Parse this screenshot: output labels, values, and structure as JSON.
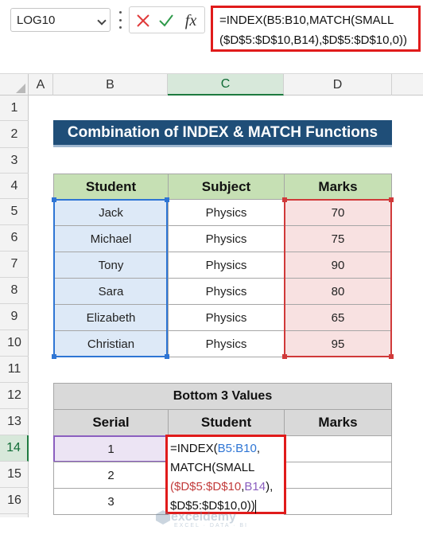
{
  "formula_bar": {
    "name_box": "LOG10",
    "fx_label": "fx",
    "formula_line1": "=INDEX(B5:B10,MATCH(SMALL",
    "formula_line2": "($D$5:$D$10,B14),$D$5:$D$10,0))"
  },
  "columns": [
    "A",
    "B",
    "C",
    "D"
  ],
  "rows": [
    "1",
    "2",
    "3",
    "4",
    "5",
    "6",
    "7",
    "8",
    "9",
    "10",
    "11",
    "12",
    "13",
    "14",
    "15",
    "16"
  ],
  "title": "Combination of INDEX & MATCH Functions",
  "main_table": {
    "headers": [
      "Student",
      "Subject",
      "Marks"
    ],
    "rows": [
      [
        "Jack",
        "Physics",
        "70"
      ],
      [
        "Michael",
        "Physics",
        "75"
      ],
      [
        "Tony",
        "Physics",
        "90"
      ],
      [
        "Sara",
        "Physics",
        "80"
      ],
      [
        "Elizabeth",
        "Physics",
        "65"
      ],
      [
        "Christian",
        "Physics",
        "95"
      ]
    ]
  },
  "bottom_table": {
    "title": "Bottom 3 Values",
    "headers": [
      "Serial",
      "Student",
      "Marks"
    ],
    "serials": [
      "1",
      "2",
      "3"
    ]
  },
  "edit_cell": {
    "l1a": "=INDEX(",
    "l1b": "B5:B10",
    "l1c": ",",
    "l2": "MATCH(SMALL",
    "l3a": "($D$5:$D$10",
    "l3b": ",",
    "l3c": "B14",
    "l3d": "),",
    "l4": "$D$5:$D$10,0))"
  },
  "watermark": {
    "name": "exceldemy",
    "tagline": "EXCEL · DATA · BI"
  },
  "colors": {
    "header_green": "#c6e0b4",
    "title_blue": "#1f4e78",
    "student_range": "#2e75d4",
    "marks_range": "#d03a3a",
    "active_border": "#e01b1b"
  }
}
